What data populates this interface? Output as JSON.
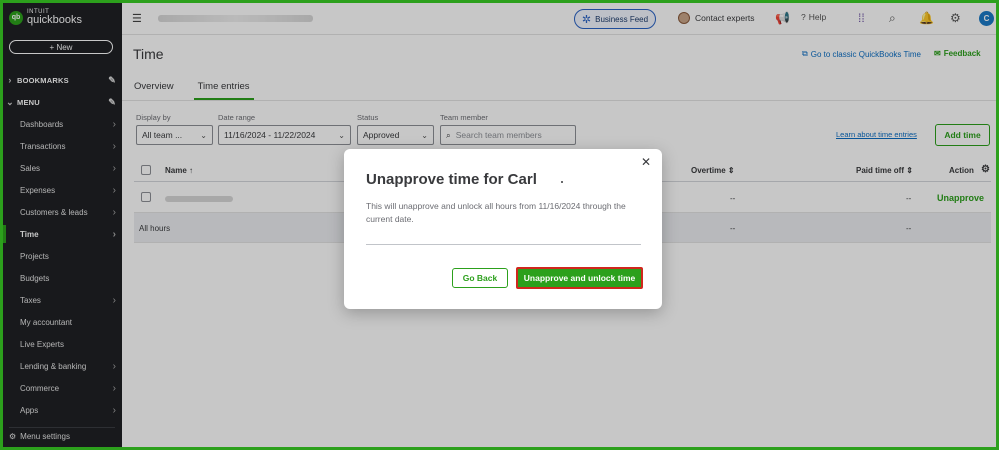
{
  "app": {
    "logo_top": "INTUIT",
    "logo_bottom": "quickbooks",
    "logo_badge": "qb"
  },
  "sidebar": {
    "new_label": "+ New",
    "bookmarks_label": "BOOKMARKS",
    "menu_label": "MENU",
    "items": [
      {
        "label": "Dashboards",
        "has_arrow": true
      },
      {
        "label": "Transactions",
        "has_arrow": true
      },
      {
        "label": "Sales",
        "has_arrow": true
      },
      {
        "label": "Expenses",
        "has_arrow": true
      },
      {
        "label": "Customers & leads",
        "has_arrow": true
      },
      {
        "label": "Time",
        "has_arrow": true,
        "active": true
      },
      {
        "label": "Projects",
        "has_arrow": false
      },
      {
        "label": "Budgets",
        "has_arrow": false
      },
      {
        "label": "Taxes",
        "has_arrow": true
      },
      {
        "label": "My accountant",
        "has_arrow": false
      },
      {
        "label": "Live Experts",
        "has_arrow": false
      },
      {
        "label": "Lending & banking",
        "has_arrow": true
      },
      {
        "label": "Commerce",
        "has_arrow": true
      },
      {
        "label": "Apps",
        "has_arrow": true
      }
    ],
    "footer_label": "Menu settings"
  },
  "topbar": {
    "business_feed": "Business Feed",
    "contact_experts": "Contact experts",
    "help": "Help",
    "user_initial": "C"
  },
  "page": {
    "title": "Time",
    "classic_link": "Go to classic QuickBooks Time",
    "feedback": "Feedback",
    "tabs": [
      "Overview",
      "Time entries"
    ],
    "active_tab": "Time entries"
  },
  "filters": {
    "display_by_label": "Display by",
    "display_by_value": "All team ...",
    "date_range_label": "Date range",
    "date_range_value": "11/16/2024 - 11/22/2024",
    "status_label": "Status",
    "status_value": "Approved",
    "team_member_label": "Team member",
    "team_member_placeholder": "Search team members",
    "learn_link": "Learn about time entries",
    "add_time": "Add time"
  },
  "table": {
    "headers": {
      "name": "Name",
      "overtime": "Overtime",
      "paid_time_off": "Paid time off",
      "action": "Action"
    },
    "rows": [
      {
        "overtime": "--",
        "paid_time_off": "--",
        "action": "Unapprove"
      }
    ],
    "total_row": {
      "label": "All hours",
      "overtime": "--",
      "paid_time_off": "--"
    }
  },
  "modal": {
    "title": "Unapprove time for Carl",
    "body": "This will unapprove and unlock all hours from 11/16/2024 through the current date.",
    "go_back": "Go Back",
    "confirm": "Unapprove and unlock time"
  },
  "colors": {
    "brand_green": "#2ca01c",
    "highlight_red": "#d0271d",
    "link_blue": "#0b6ec4"
  }
}
